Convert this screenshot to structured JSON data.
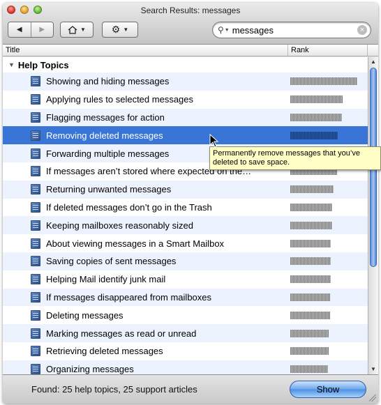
{
  "window": {
    "title": "Search Results: messages"
  },
  "toolbar": {
    "back_icon": "back-arrow-icon",
    "forward_icon": "forward-arrow-icon",
    "home_icon": "home-icon",
    "action_icon": "gear-icon"
  },
  "search": {
    "value": "messages",
    "placeholder": ""
  },
  "columns": {
    "title": "Title",
    "rank": "Rank"
  },
  "group": {
    "label": "Help Topics"
  },
  "results": [
    {
      "label": "Showing and hiding messages",
      "rank": 1.0
    },
    {
      "label": "Applying rules to selected messages",
      "rank": 0.78
    },
    {
      "label": "Flagging messages for action",
      "rank": 0.77
    },
    {
      "label": "Removing deleted messages",
      "rank": 0.71
    },
    {
      "label": "Forwarding multiple messages",
      "rank": 0.69
    },
    {
      "label": "If messages aren’t stored where expected on the…",
      "rank": 0.7
    },
    {
      "label": "Returning unwanted messages",
      "rank": 0.65
    },
    {
      "label": "If deleted messages don’t go in the Trash",
      "rank": 0.63
    },
    {
      "label": "Keeping mailboxes reasonably sized",
      "rank": 0.62
    },
    {
      "label": "About viewing messages in a Smart Mailbox",
      "rank": 0.6
    },
    {
      "label": "Saving copies of sent messages",
      "rank": 0.6
    },
    {
      "label": "Helping Mail identify junk mail",
      "rank": 0.6
    },
    {
      "label": "If messages disappeared from mailboxes",
      "rank": 0.59
    },
    {
      "label": "Deleting messages",
      "rank": 0.59
    },
    {
      "label": "Marking messages as read or unread",
      "rank": 0.57
    },
    {
      "label": "Retrieving deleted messages",
      "rank": 0.57
    },
    {
      "label": "Organizing messages",
      "rank": 0.56
    }
  ],
  "selected_index": 3,
  "tooltip": {
    "line1": "Permanently remove messages that you’ve",
    "line2": "deleted to save space."
  },
  "footer": {
    "status": "Found: 25 help topics, 25 support articles",
    "show_label": "Show"
  },
  "colors": {
    "selection": "#3875d7",
    "alt_row": "#edf3fe",
    "tooltip_bg": "#fefec6"
  }
}
